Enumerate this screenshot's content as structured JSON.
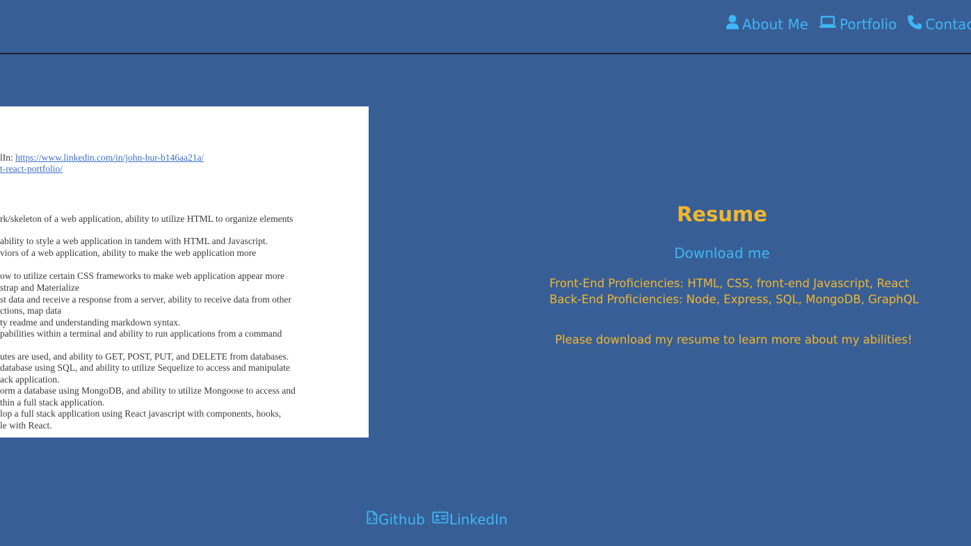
{
  "nav": {
    "items": [
      {
        "label": "About Me",
        "icon": "user-icon"
      },
      {
        "label": "Portfolio",
        "icon": "laptop-icon"
      },
      {
        "label": "Contact",
        "icon": "phone-icon"
      }
    ]
  },
  "resume_image": {
    "lines": [
      {
        "prefix": "lIn: ",
        "link": "https://www.linkedin.com/in/john-hur-b146aa21a/"
      },
      {
        "prefix": "",
        "link": "t-react-portfolio/"
      },
      {
        "text": "rk/skeleton of a web application, ability to utilize HTML to organize elements"
      },
      {
        "text": "ability to style a web application in tandem with HTML and Javascript."
      },
      {
        "text": "viors of a web application, ability to make the web application more"
      },
      {
        "text": "ow to utilize certain CSS frameworks to make web application appear more"
      },
      {
        "text": "strap and Materialize"
      },
      {
        "text": "st data and receive a response from a server, ability to receive data from other"
      },
      {
        "text": "ctions, map data"
      },
      {
        "text": "ty readme and understanding markdown syntax."
      },
      {
        "text": "pabilities within a terminal and ability to run applications from a command"
      },
      {
        "text": "utes are used, and ability to GET, POST, PUT, and DELETE from databases."
      },
      {
        "text": " database using SQL, and ability to utilize Sequelize to access and manipulate"
      },
      {
        "text": "ack application."
      },
      {
        "text": "orm a database using MongoDB, and ability to utilize Mongoose to access and"
      },
      {
        "text": "thin a full stack application."
      },
      {
        "text": "lop a full stack application using React javascript with components, hooks,"
      },
      {
        "text": "le with React."
      }
    ]
  },
  "resume": {
    "title": "Resume",
    "download_label": "Download me",
    "front_end": "Front-End Proficiencies: HTML, CSS, front-end Javascript, React",
    "back_end": "Back-End Proficiencies: Node, Express, SQL, MongoDB, GraphQL",
    "note": "Please download my resume to learn more about my abilities!"
  },
  "footer": {
    "github_label": "Github",
    "linkedin_label": "LinkedIn"
  },
  "colors": {
    "background": "#385e96",
    "accent_blue": "#3fb6f5",
    "accent_gold": "#f2b72d"
  }
}
